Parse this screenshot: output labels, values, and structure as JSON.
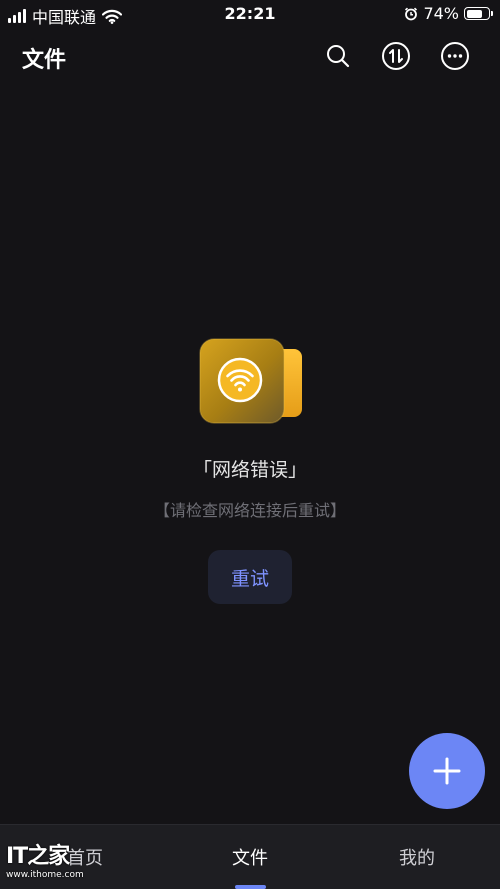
{
  "status_bar": {
    "carrier": "中国联通",
    "time": "22:21",
    "battery_percent": "74%",
    "battery_level": 0.74,
    "icons": [
      "signal-icon",
      "wifi-icon",
      "alarm-icon",
      "battery-icon"
    ]
  },
  "header": {
    "title": "文件",
    "actions": [
      "search-icon",
      "transfer-icon",
      "more-icon"
    ]
  },
  "empty_state": {
    "icon": "network-error-icon",
    "title": "「网络错误」",
    "hint": "【请检查网络连接后重试】",
    "retry_label": "重试"
  },
  "fab": {
    "icon": "plus-icon"
  },
  "tabs": [
    {
      "label": "首页",
      "active": false
    },
    {
      "label": "文件",
      "active": true
    },
    {
      "label": "我的",
      "active": false
    }
  ],
  "watermark": {
    "logo": "IT之家",
    "url": "www.ithome.com"
  },
  "colors": {
    "background": "#141316",
    "accent": "#6c86f5",
    "retry_text": "#7f93ff",
    "folder_gold": "#c99a1c",
    "folder_tab": "#f2b528"
  }
}
